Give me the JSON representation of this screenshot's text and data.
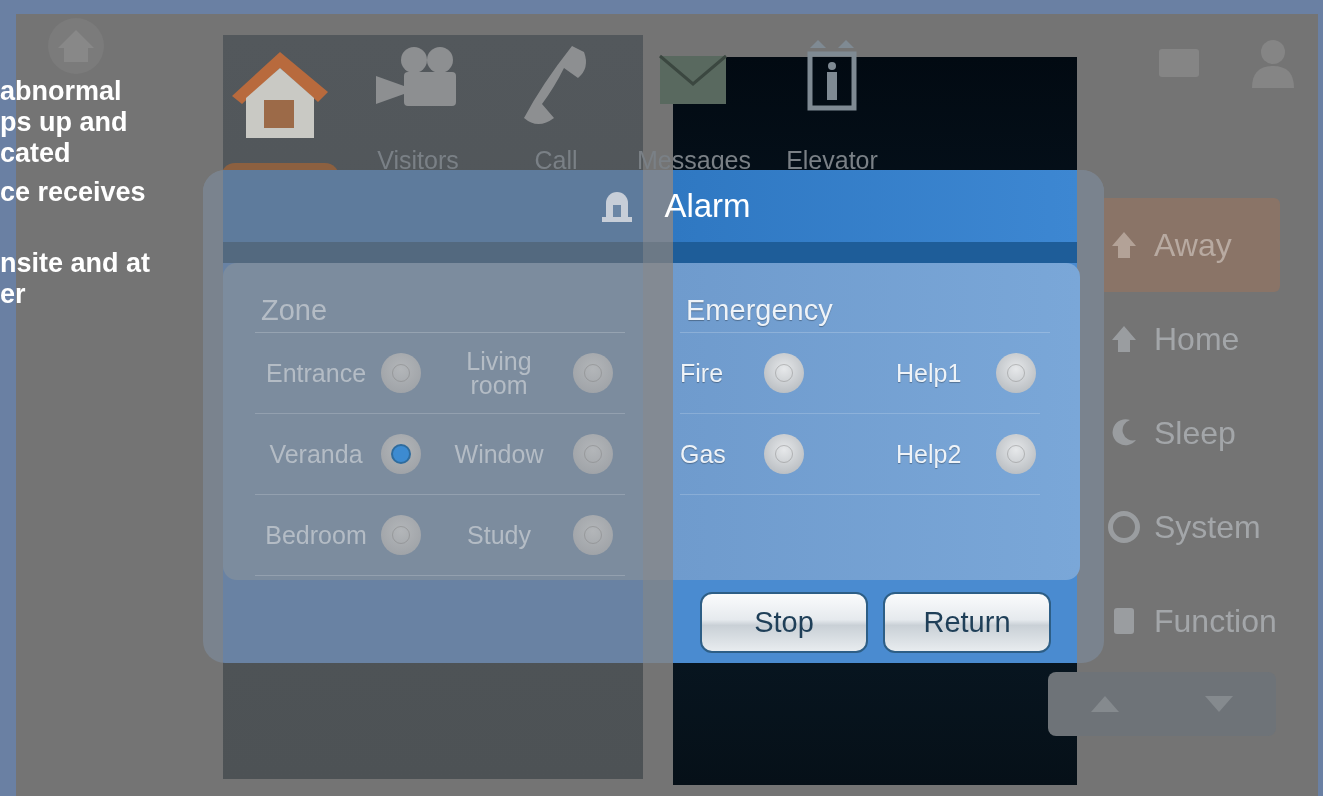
{
  "article_text": [
    {
      "lines": [
        "abnormal",
        "ps up and",
        "cated"
      ]
    },
    {
      "lines": [
        "ce receives"
      ]
    },
    {
      "lines": [
        "nsite and at",
        "er"
      ]
    }
  ],
  "device": {
    "nav_tabs": [
      {
        "kind": "home",
        "selected": true
      },
      {
        "kind": "visitors",
        "label": "Visitors",
        "selected": false
      },
      {
        "kind": "call",
        "label": "Call",
        "selected": false
      },
      {
        "kind": "messages",
        "label": "Messages",
        "selected": false
      },
      {
        "kind": "elevator",
        "label": "Elevator",
        "selected": false
      }
    ],
    "modes": [
      {
        "kind": "away",
        "label": "Away",
        "selected": true
      },
      {
        "kind": "home",
        "label": "Home",
        "selected": false
      },
      {
        "kind": "sleep",
        "label": "Sleep",
        "selected": false
      },
      {
        "kind": "system",
        "label": "System",
        "selected": false
      },
      {
        "kind": "function",
        "label": "Function",
        "selected": false
      }
    ],
    "alarm_dialog": {
      "title": "Alarm",
      "zone": {
        "heading": "Zone",
        "items": [
          {
            "label": "Entrance",
            "selected": false
          },
          {
            "label": "Living room",
            "selected": false
          },
          {
            "label": "Veranda",
            "selected": true
          },
          {
            "label": "Window",
            "selected": false
          },
          {
            "label": "Bedroom",
            "selected": false
          },
          {
            "label": "Study",
            "selected": false
          }
        ]
      },
      "emergency": {
        "heading": "Emergency",
        "items": [
          {
            "label": "Fire",
            "selected": false
          },
          {
            "label": "Help1",
            "selected": false
          },
          {
            "label": "Gas",
            "selected": false
          },
          {
            "label": "Help2",
            "selected": false
          }
        ]
      },
      "buttons": [
        "Stop",
        "Return"
      ]
    }
  }
}
